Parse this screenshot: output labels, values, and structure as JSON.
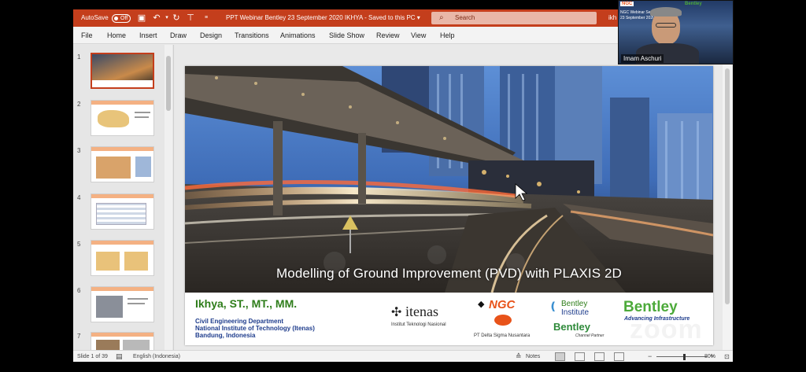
{
  "titlebar": {
    "autosave_label": "AutoSave",
    "autosave_state": "Off",
    "document_title": "PPT Webinar Bentley 23 September 2020 IKHYA  -  Saved to this PC ▾",
    "search_placeholder": "Search",
    "user_initials": "ikh"
  },
  "menu": [
    "File",
    "Home",
    "Insert",
    "Draw",
    "Design",
    "Transitions",
    "Animations",
    "Slide Show",
    "Review",
    "View",
    "Help"
  ],
  "thumbnails": [
    "1",
    "2",
    "3",
    "4",
    "5",
    "6",
    "7"
  ],
  "slide": {
    "title": "Modelling of Ground Improvement (PVD) with PLAXIS 2D",
    "author": "Ikhya, ST., MT., MM.",
    "affiliation": [
      "Civil Engineering Department",
      "National Institute of Technology (Itenas)",
      "Bandung, Indonesia"
    ],
    "logos": {
      "itenas": "itenas",
      "itenas_sub": "Institut Teknologi Nasional",
      "ngc": "NGC",
      "delta": "PT Delta Sigma Nusantara",
      "bentley_institute": "Bentley",
      "bentley_institute_sub": "Institute",
      "bentley_channel": "Bentley",
      "bentley_channel_sub": "Channel Partner",
      "bentley_main": "Bentley",
      "bentley_main_sub": "Advancing Infrastructure"
    }
  },
  "statusbar": {
    "slide_count": "Slide 1 of 39",
    "language": "English (Indonesia)",
    "notes_label": "Notes",
    "zoom": "80%"
  },
  "webcam": {
    "name": "Imam Aschuri",
    "caption_line1": "NGC Webinar Series",
    "caption_line2": "23 September 2020"
  },
  "watermark": "zoom",
  "colors": {
    "ribbon": "#c43e1c",
    "author_green": "#2e7d1a",
    "affil_blue": "#1e3c8c"
  }
}
